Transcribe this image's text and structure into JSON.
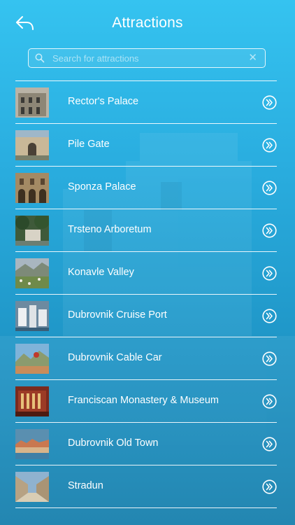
{
  "header": {
    "title": "Attractions"
  },
  "search": {
    "placeholder": "Search for attractions",
    "value": ""
  },
  "attractions": [
    {
      "name": "Rector's Palace"
    },
    {
      "name": "Pile Gate"
    },
    {
      "name": "Sponza Palace"
    },
    {
      "name": "Trsteno Arboretum"
    },
    {
      "name": "Konavle Valley"
    },
    {
      "name": "Dubrovnik Cruise Port"
    },
    {
      "name": "Dubrovnik Cable Car"
    },
    {
      "name": "Franciscan Monastery & Museum"
    },
    {
      "name": "Dubrovnik Old Town"
    },
    {
      "name": "Stradun"
    }
  ],
  "theme": {
    "background_top": "#35c3f0",
    "background_bottom": "#167fad",
    "line_color": "#ffffff"
  }
}
